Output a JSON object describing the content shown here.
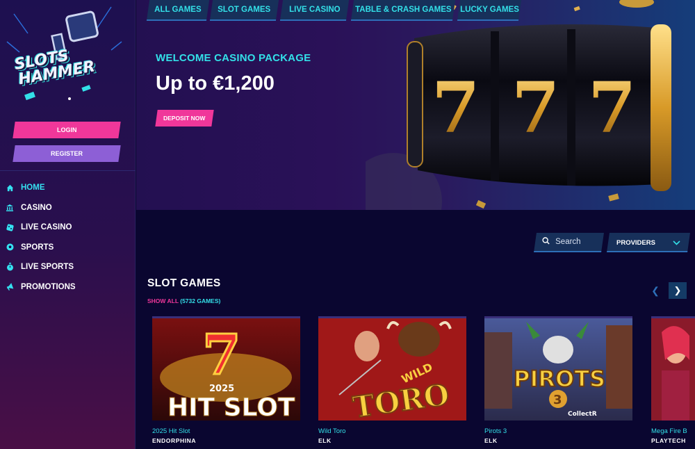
{
  "brand": {
    "logo_line1": "SLOTS",
    "logo_line2": "HAMMER"
  },
  "auth": {
    "login_label": "LOGIN",
    "register_label": "REGISTER"
  },
  "sidebar": {
    "items": [
      {
        "label": "HOME",
        "icon": "home-icon",
        "active": true
      },
      {
        "label": "CASINO",
        "icon": "casino-icon"
      },
      {
        "label": "LIVE CASINO",
        "icon": "dice-icon"
      },
      {
        "label": "SPORTS",
        "icon": "ball-icon"
      },
      {
        "label": "LIVE SPORTS",
        "icon": "stopwatch-icon"
      },
      {
        "label": "PROMOTIONS",
        "icon": "megaphone-icon"
      }
    ]
  },
  "hero": {
    "subtitle": "WELCOME CASINO PACKAGE",
    "title": "Up to €1,200",
    "cta_label": "DEPOSIT NOW"
  },
  "tabs": [
    "ALL GAMES",
    "SLOT GAMES",
    "LIVE CASINO",
    "TABLE & CRASH GAMES",
    "LUCKY GAMES"
  ],
  "search": {
    "placeholder": "Search"
  },
  "providers": {
    "label": "PROVIDERS"
  },
  "section": {
    "title": "SLOT GAMES",
    "show_all": "SHOW ALL",
    "count": "(5732 GAMES)"
  },
  "games": [
    {
      "name": "2025 Hit Slot",
      "provider": "ENDORPHINA",
      "art_text": "2025 HIT SLOT"
    },
    {
      "name": "Wild Toro",
      "provider": "ELK",
      "art_text": "WILD TORO"
    },
    {
      "name": "Pirots 3",
      "provider": "ELK",
      "art_text": "PIROTS 3"
    },
    {
      "name": "Mega Fire B",
      "provider": "PLAYTECH",
      "art_text": ""
    }
  ],
  "colors": {
    "accent_cyan": "#33e0e8",
    "accent_pink": "#f0379a",
    "accent_purple": "#8d5fd6",
    "tab_bg": "#17305a"
  }
}
